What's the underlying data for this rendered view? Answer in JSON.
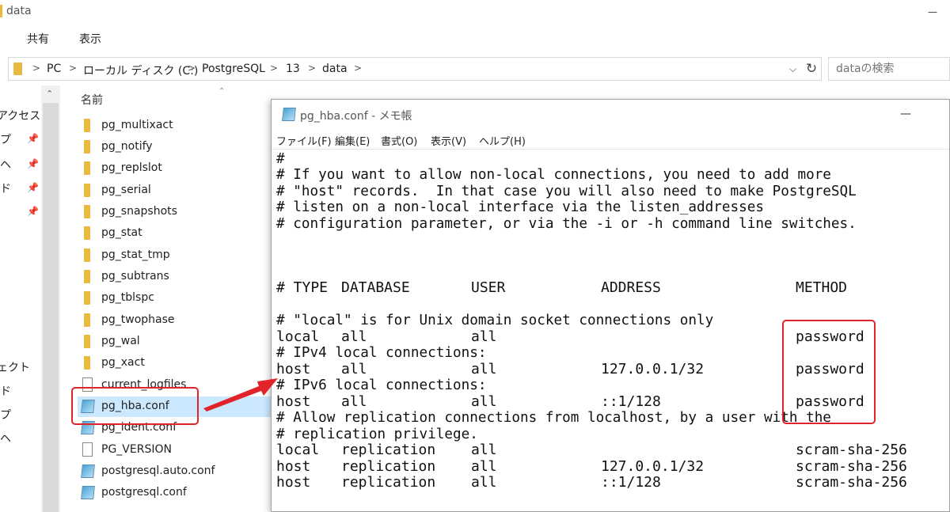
{
  "explorer": {
    "title": "data",
    "ribbon_tabs": [
      "共有",
      "表示"
    ],
    "address": {
      "crumbs": [
        "PC",
        "ローカル ディスク (C:)",
        "PostgreSQL",
        "13",
        "data"
      ]
    },
    "search_placeholder": "dataの検索",
    "nav_items": [
      {
        "label": "アクセス"
      },
      {
        "label": "プ"
      },
      {
        "label": "ヘ"
      },
      {
        "label": "ド"
      },
      {
        "label": "ェクト"
      },
      {
        "label": "ド"
      },
      {
        "label": "プ"
      },
      {
        "label": "ヘ"
      }
    ],
    "column_header_name": "名前",
    "files": [
      {
        "name": "pg_multixact",
        "type": "folder"
      },
      {
        "name": "pg_notify",
        "type": "folder"
      },
      {
        "name": "pg_replslot",
        "type": "folder"
      },
      {
        "name": "pg_serial",
        "type": "folder"
      },
      {
        "name": "pg_snapshots",
        "type": "folder"
      },
      {
        "name": "pg_stat",
        "type": "folder"
      },
      {
        "name": "pg_stat_tmp",
        "type": "folder"
      },
      {
        "name": "pg_subtrans",
        "type": "folder"
      },
      {
        "name": "pg_tblspc",
        "type": "folder"
      },
      {
        "name": "pg_twophase",
        "type": "folder"
      },
      {
        "name": "pg_wal",
        "type": "folder"
      },
      {
        "name": "pg_xact",
        "type": "folder"
      },
      {
        "name": "current_logfiles",
        "type": "file"
      },
      {
        "name": "pg_hba.conf",
        "type": "conf",
        "selected": true
      },
      {
        "name": "pg_ident.conf",
        "type": "conf"
      },
      {
        "name": "PG_VERSION",
        "type": "file"
      },
      {
        "name": "postgresql.auto.conf",
        "type": "conf"
      },
      {
        "name": "postgresql.conf",
        "type": "conf"
      }
    ]
  },
  "notepad": {
    "title": "pg_hba.conf - メモ帳",
    "menus": [
      "ファイル(F)",
      "編集(E)",
      "書式(O)",
      "表示(V)",
      "ヘルプ(H)"
    ],
    "comment_lines": [
      "#",
      "# If you want to allow non-local connections, you need to add more",
      "# \"host\" records.  In that case you will also need to make PostgreSQL",
      "# listen on a non-local interface via the listen_addresses",
      "# configuration parameter, or via the -i or -h command line switches."
    ],
    "header": {
      "type": "# TYPE",
      "database": "DATABASE",
      "user": "USER",
      "address": "ADDRESS",
      "method": "METHOD"
    },
    "body_lines": [
      {
        "kind": "comment",
        "text": "# \"local\" is for Unix domain socket connections only"
      },
      {
        "kind": "row",
        "type": "local",
        "database": "all",
        "user": "all",
        "address": "",
        "method": "password"
      },
      {
        "kind": "comment",
        "text": "# IPv4 local connections:"
      },
      {
        "kind": "row",
        "type": "host",
        "database": "all",
        "user": "all",
        "address": "127.0.0.1/32",
        "method": "password"
      },
      {
        "kind": "comment",
        "text": "# IPv6 local connections:"
      },
      {
        "kind": "row",
        "type": "host",
        "database": "all",
        "user": "all",
        "address": "::1/128",
        "method": "password"
      },
      {
        "kind": "comment",
        "text": "# Allow replication connections from localhost, by a user with the"
      },
      {
        "kind": "comment",
        "text": "# replication privilege."
      },
      {
        "kind": "row",
        "type": "local",
        "database": "replication",
        "user": "all",
        "address": "",
        "method": "scram-sha-256"
      },
      {
        "kind": "row",
        "type": "host",
        "database": "replication",
        "user": "all",
        "address": "127.0.0.1/32",
        "method": "scram-sha-256"
      },
      {
        "kind": "row",
        "type": "host",
        "database": "replication",
        "user": "all",
        "address": "::1/128",
        "method": "scram-sha-256"
      }
    ]
  },
  "annotation_color": "#e0242a"
}
